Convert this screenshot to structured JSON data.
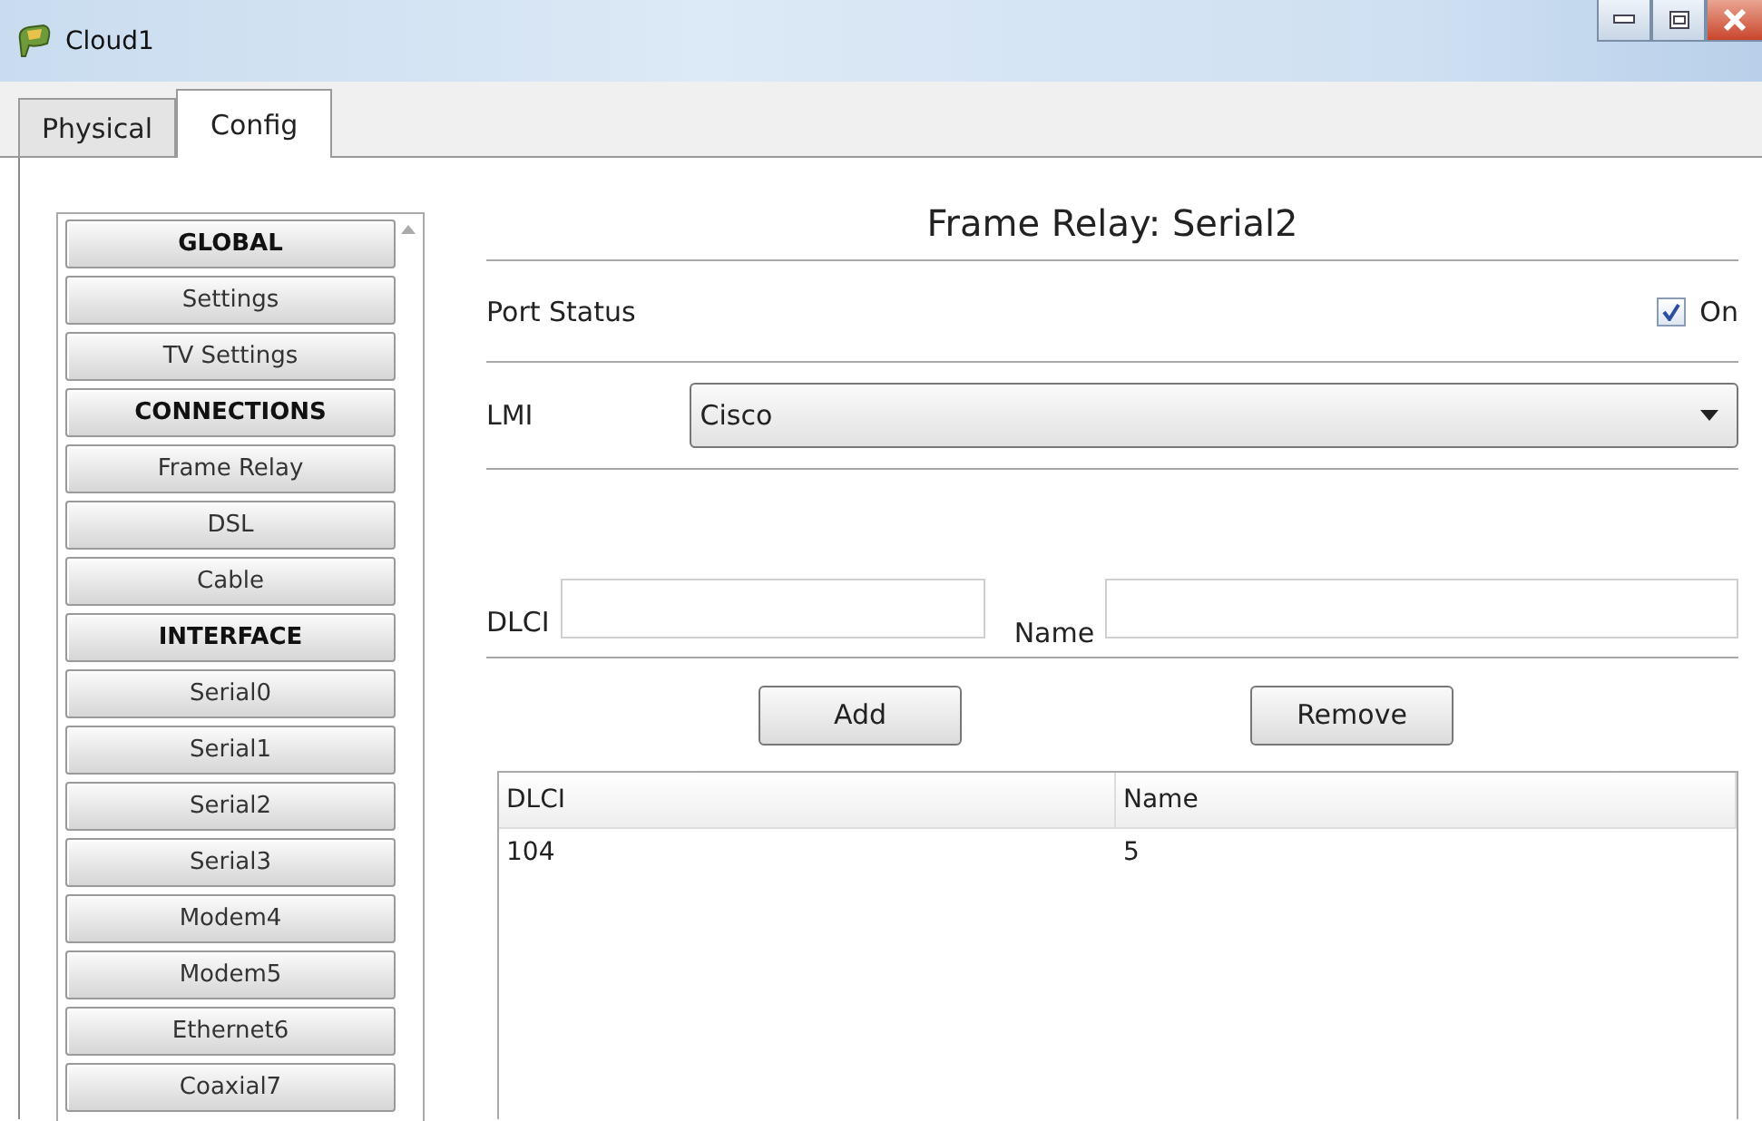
{
  "window": {
    "title": "Cloud1"
  },
  "tabs": [
    {
      "label": "Physical",
      "selected": false
    },
    {
      "label": "Config",
      "selected": true
    }
  ],
  "sidebar": {
    "items": [
      {
        "label": "GLOBAL",
        "kind": "header"
      },
      {
        "label": "Settings",
        "kind": "item"
      },
      {
        "label": "TV Settings",
        "kind": "item"
      },
      {
        "label": "CONNECTIONS",
        "kind": "header"
      },
      {
        "label": "Frame Relay",
        "kind": "item"
      },
      {
        "label": "DSL",
        "kind": "item"
      },
      {
        "label": "Cable",
        "kind": "item"
      },
      {
        "label": "INTERFACE",
        "kind": "header"
      },
      {
        "label": "Serial0",
        "kind": "item"
      },
      {
        "label": "Serial1",
        "kind": "item"
      },
      {
        "label": "Serial2",
        "kind": "item"
      },
      {
        "label": "Serial3",
        "kind": "item"
      },
      {
        "label": "Modem4",
        "kind": "item"
      },
      {
        "label": "Modem5",
        "kind": "item"
      },
      {
        "label": "Ethernet6",
        "kind": "item"
      },
      {
        "label": "Coaxial7",
        "kind": "item"
      }
    ]
  },
  "panel": {
    "title": "Frame Relay: Serial2",
    "port_status": {
      "label": "Port Status",
      "checkbox_label": "On",
      "checked": true
    },
    "lmi": {
      "label": "LMI",
      "value": "Cisco"
    },
    "dlci_label": "DLCI",
    "name_label": "Name",
    "buttons": [
      "Add",
      "Remove"
    ],
    "table": {
      "columns": [
        "DLCI",
        "Name"
      ],
      "rows": [
        [
          "104",
          "5"
        ]
      ]
    }
  }
}
